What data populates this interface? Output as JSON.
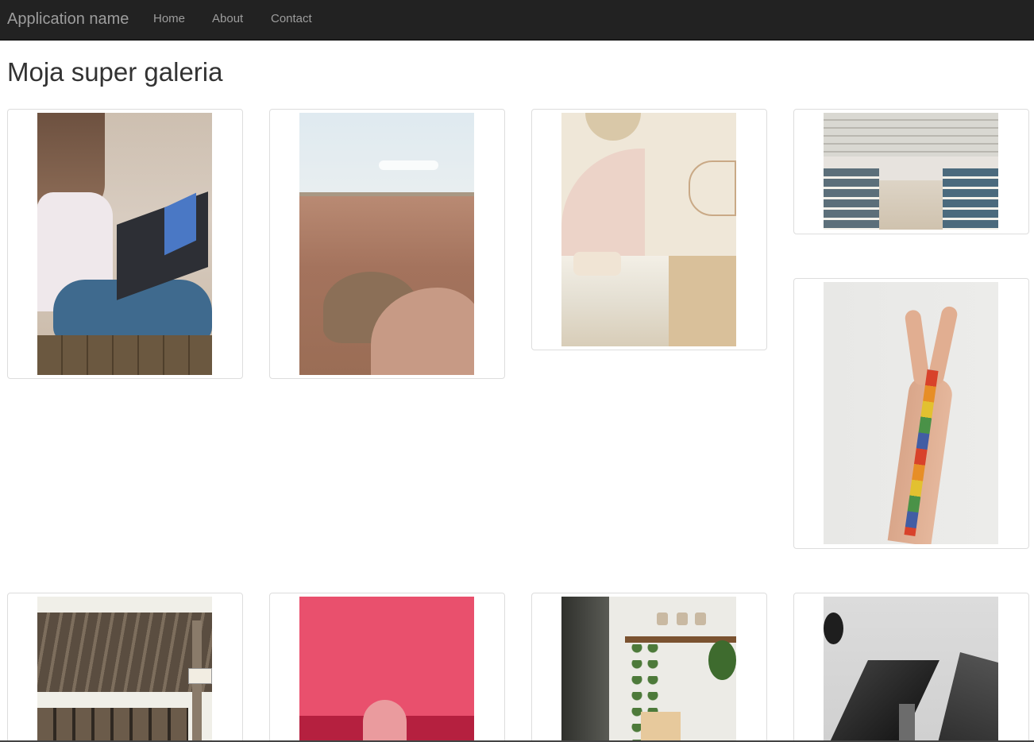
{
  "navbar": {
    "brand": "Application name",
    "links": [
      {
        "label": "Home"
      },
      {
        "label": "About"
      },
      {
        "label": "Contact"
      }
    ]
  },
  "page": {
    "title": "Moja super galeria"
  },
  "gallery": {
    "items": [
      {
        "subject": "woman-with-laptop-photo"
      },
      {
        "subject": "canyon-photo"
      },
      {
        "subject": "bedroom-photo"
      },
      {
        "subject": "library-photo"
      },
      {
        "subject": "peace-sign-hand-photo"
      },
      {
        "subject": "wooden-porch-photo"
      },
      {
        "subject": "pink-wall-statue-photo"
      },
      {
        "subject": "plants-interior-photo"
      },
      {
        "subject": "skyscrapers-photo"
      }
    ]
  },
  "colors": {
    "navbar_bg": "#222222",
    "nav_text": "#9d9d9d",
    "title_text": "#333333",
    "thumbnail_border": "#dddddd"
  }
}
